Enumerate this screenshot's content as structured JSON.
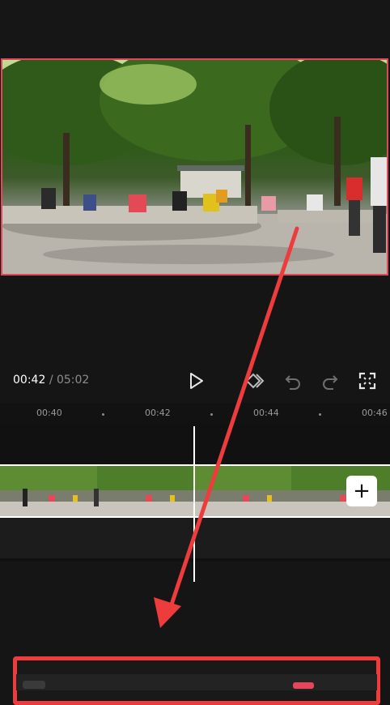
{
  "player": {
    "current_time": "00:42",
    "separator": "/",
    "duration": "05:02"
  },
  "ruler": {
    "ticks": [
      "00:40",
      "00:42",
      "00:44",
      "00:46"
    ]
  },
  "timeline": {
    "add_clip_label": "+"
  },
  "icons": {
    "play": "play-icon",
    "keyframe": "keyframe-icon",
    "undo": "undo-icon",
    "redo": "redo-icon",
    "fullscreen": "fullscreen-icon"
  },
  "colors": {
    "highlight_red": "#ee3c3c",
    "preview_border": "#e4475a",
    "background": "#151515"
  }
}
